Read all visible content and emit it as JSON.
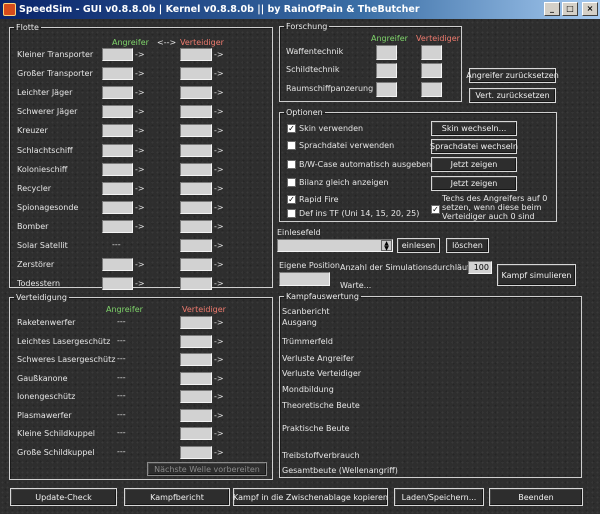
{
  "window": {
    "title": "SpeedSim - GUI v0.8.8.0b | Kernel v0.8.8.0b  ||  by RainOfPain & TheButcher",
    "buttons": [
      "_",
      "□",
      "×"
    ]
  },
  "flotte": {
    "legend": "Flotte",
    "attacker_header": "Angreifer",
    "swap_label": "<-->",
    "defender_header": "Verteidiger",
    "rows": [
      {
        "label": "Kleiner Transporter",
        "attacker": "",
        "defender": ""
      },
      {
        "label": "Großer Transporter",
        "attacker": "",
        "defender": ""
      },
      {
        "label": "Leichter Jäger",
        "attacker": "",
        "defender": ""
      },
      {
        "label": "Schwerer Jäger",
        "attacker": "",
        "defender": ""
      },
      {
        "label": "Kreuzer",
        "attacker": "",
        "defender": ""
      },
      {
        "label": "Schlachtschiff",
        "attacker": "",
        "defender": ""
      },
      {
        "label": "Kolonieschiff",
        "attacker": "",
        "defender": ""
      },
      {
        "label": "Recycler",
        "attacker": "",
        "defender": ""
      },
      {
        "label": "Spionagesonde",
        "attacker": "",
        "defender": ""
      },
      {
        "label": "Bomber",
        "attacker": "",
        "defender": ""
      },
      {
        "label": "Solar Satellit",
        "attacker": "---",
        "defender": ""
      },
      {
        "label": "Zerstörer",
        "attacker": "",
        "defender": ""
      },
      {
        "label": "Todesstern",
        "attacker": "",
        "defender": ""
      }
    ],
    "arrow": "->"
  },
  "verteidigung": {
    "legend": "Verteidigung",
    "attacker_header": "Angreifer",
    "defender_header": "Verteidiger",
    "rows": [
      {
        "label": "Raketenwerfer",
        "attacker": "---",
        "defender": ""
      },
      {
        "label": "Leichtes Lasergeschütz",
        "attacker": "---",
        "defender": ""
      },
      {
        "label": "Schweres Lasergeschütz",
        "attacker": "---",
        "defender": ""
      },
      {
        "label": "Gaußkanone",
        "attacker": "---",
        "defender": ""
      },
      {
        "label": "Ionengeschütz",
        "attacker": "---",
        "defender": ""
      },
      {
        "label": "Plasmawerfer",
        "attacker": "---",
        "defender": ""
      },
      {
        "label": "Kleine Schildkuppel",
        "attacker": "---",
        "defender": ""
      },
      {
        "label": "Große Schildkuppel",
        "attacker": "---",
        "defender": ""
      }
    ],
    "next_wave_button": "Nächste Welle vorbereiten"
  },
  "forschung": {
    "legend": "Forschung",
    "attacker_header": "Angreifer",
    "defender_header": "Verteidiger",
    "rows": [
      {
        "label": "Waffentechnik",
        "attacker": "",
        "defender": ""
      },
      {
        "label": "Schildtechnik",
        "attacker": "",
        "defender": ""
      },
      {
        "label": "Raumschiffpanzerung",
        "attacker": "",
        "defender": ""
      }
    ],
    "reset_attacker_button": "Angreifer zurücksetzen",
    "reset_defender_button": "Vert. zurücksetzen"
  },
  "optionen": {
    "legend": "Optionen",
    "checkboxes": [
      {
        "label": "Skin verwenden",
        "checked": true
      },
      {
        "label": "Sprachdatei verwenden",
        "checked": false
      },
      {
        "label": "B/W-Case automatisch ausgeben",
        "checked": false
      },
      {
        "label": "Bilanz gleich anzeigen",
        "checked": false
      },
      {
        "label": "Rapid Fire",
        "checked": true
      },
      {
        "label": "Def ins TF (Uni 14, 15, 20, 25)",
        "checked": false
      }
    ],
    "skin_button": "Skin wechseln...",
    "lang_button": "Sprachdatei wechseln",
    "show_now_1": "Jetzt zeigen",
    "show_now_2": "Jetzt zeigen",
    "techs_checkbox": {
      "label": "Techs des Angreifers auf 0 setzen, wenn diese beim Verteidiger auch 0 sind",
      "checked": true
    }
  },
  "einlesefeld": {
    "label": "Einlesefeld",
    "read_button": "einlesen",
    "clear_button": "löschen"
  },
  "simulation": {
    "own_position_label": "Eigene Position",
    "runs_label": "Anzahl der Simulationsdurchläufe",
    "runs_value": "100",
    "wait_label": "Warte...",
    "simulate_button": "Kampf simulieren"
  },
  "kampfauswertung": {
    "legend": "Kampfauswertung",
    "items": [
      "Scanbericht",
      "Ausgang",
      "Trümmerfeld",
      "Verluste Angreifer",
      "Verluste Verteidiger",
      "Mondbildung",
      "Theoretische Beute",
      "Praktische Beute",
      "Treibstoffverbrauch",
      "Gesamtbeute (Wellenangriff)"
    ]
  },
  "bottom": {
    "update_button": "Update-Check",
    "report_button": "Kampfbericht",
    "clipboard_button": "Kampf in die Zwischenablage kopieren",
    "load_save_button": "Laden/Speichern...",
    "exit_button": "Beenden"
  }
}
